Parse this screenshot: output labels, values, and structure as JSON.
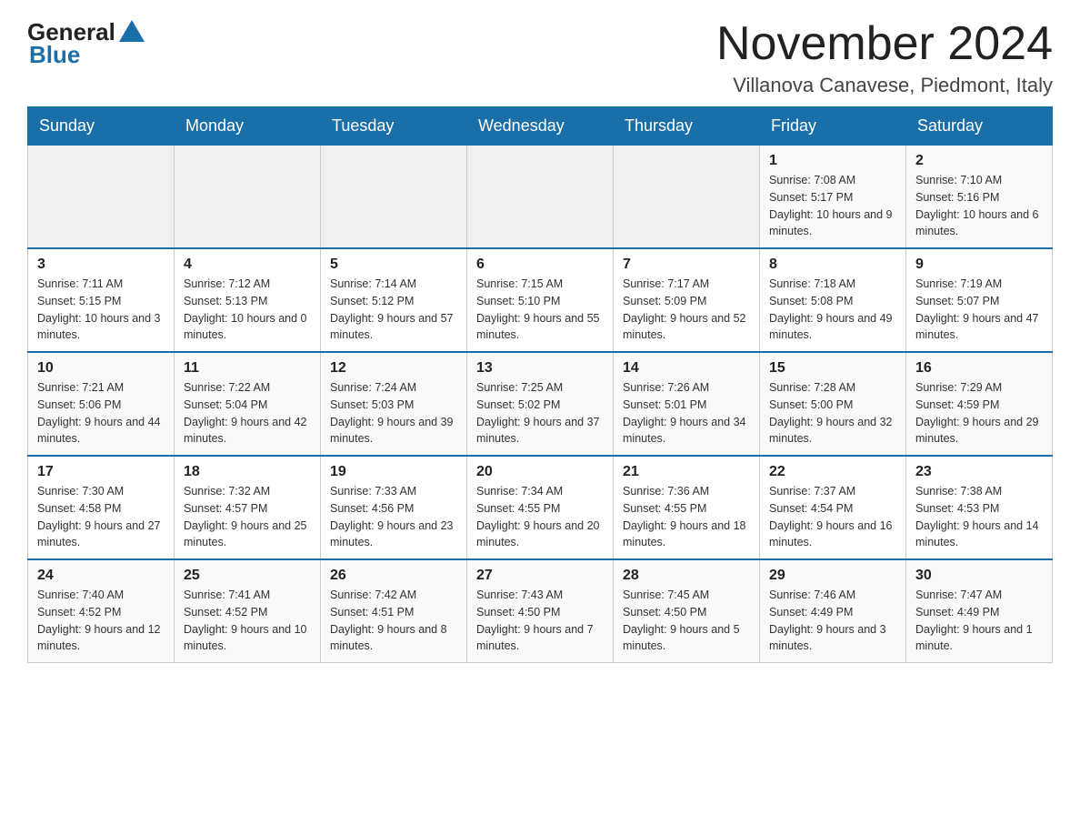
{
  "header": {
    "logo_general": "General",
    "logo_blue": "Blue",
    "month_title": "November 2024",
    "location": "Villanova Canavese, Piedmont, Italy"
  },
  "weekdays": [
    "Sunday",
    "Monday",
    "Tuesday",
    "Wednesday",
    "Thursday",
    "Friday",
    "Saturday"
  ],
  "weeks": [
    [
      {
        "day": "",
        "info": ""
      },
      {
        "day": "",
        "info": ""
      },
      {
        "day": "",
        "info": ""
      },
      {
        "day": "",
        "info": ""
      },
      {
        "day": "",
        "info": ""
      },
      {
        "day": "1",
        "info": "Sunrise: 7:08 AM\nSunset: 5:17 PM\nDaylight: 10 hours and 9 minutes."
      },
      {
        "day": "2",
        "info": "Sunrise: 7:10 AM\nSunset: 5:16 PM\nDaylight: 10 hours and 6 minutes."
      }
    ],
    [
      {
        "day": "3",
        "info": "Sunrise: 7:11 AM\nSunset: 5:15 PM\nDaylight: 10 hours and 3 minutes."
      },
      {
        "day": "4",
        "info": "Sunrise: 7:12 AM\nSunset: 5:13 PM\nDaylight: 10 hours and 0 minutes."
      },
      {
        "day": "5",
        "info": "Sunrise: 7:14 AM\nSunset: 5:12 PM\nDaylight: 9 hours and 57 minutes."
      },
      {
        "day": "6",
        "info": "Sunrise: 7:15 AM\nSunset: 5:10 PM\nDaylight: 9 hours and 55 minutes."
      },
      {
        "day": "7",
        "info": "Sunrise: 7:17 AM\nSunset: 5:09 PM\nDaylight: 9 hours and 52 minutes."
      },
      {
        "day": "8",
        "info": "Sunrise: 7:18 AM\nSunset: 5:08 PM\nDaylight: 9 hours and 49 minutes."
      },
      {
        "day": "9",
        "info": "Sunrise: 7:19 AM\nSunset: 5:07 PM\nDaylight: 9 hours and 47 minutes."
      }
    ],
    [
      {
        "day": "10",
        "info": "Sunrise: 7:21 AM\nSunset: 5:06 PM\nDaylight: 9 hours and 44 minutes."
      },
      {
        "day": "11",
        "info": "Sunrise: 7:22 AM\nSunset: 5:04 PM\nDaylight: 9 hours and 42 minutes."
      },
      {
        "day": "12",
        "info": "Sunrise: 7:24 AM\nSunset: 5:03 PM\nDaylight: 9 hours and 39 minutes."
      },
      {
        "day": "13",
        "info": "Sunrise: 7:25 AM\nSunset: 5:02 PM\nDaylight: 9 hours and 37 minutes."
      },
      {
        "day": "14",
        "info": "Sunrise: 7:26 AM\nSunset: 5:01 PM\nDaylight: 9 hours and 34 minutes."
      },
      {
        "day": "15",
        "info": "Sunrise: 7:28 AM\nSunset: 5:00 PM\nDaylight: 9 hours and 32 minutes."
      },
      {
        "day": "16",
        "info": "Sunrise: 7:29 AM\nSunset: 4:59 PM\nDaylight: 9 hours and 29 minutes."
      }
    ],
    [
      {
        "day": "17",
        "info": "Sunrise: 7:30 AM\nSunset: 4:58 PM\nDaylight: 9 hours and 27 minutes."
      },
      {
        "day": "18",
        "info": "Sunrise: 7:32 AM\nSunset: 4:57 PM\nDaylight: 9 hours and 25 minutes."
      },
      {
        "day": "19",
        "info": "Sunrise: 7:33 AM\nSunset: 4:56 PM\nDaylight: 9 hours and 23 minutes."
      },
      {
        "day": "20",
        "info": "Sunrise: 7:34 AM\nSunset: 4:55 PM\nDaylight: 9 hours and 20 minutes."
      },
      {
        "day": "21",
        "info": "Sunrise: 7:36 AM\nSunset: 4:55 PM\nDaylight: 9 hours and 18 minutes."
      },
      {
        "day": "22",
        "info": "Sunrise: 7:37 AM\nSunset: 4:54 PM\nDaylight: 9 hours and 16 minutes."
      },
      {
        "day": "23",
        "info": "Sunrise: 7:38 AM\nSunset: 4:53 PM\nDaylight: 9 hours and 14 minutes."
      }
    ],
    [
      {
        "day": "24",
        "info": "Sunrise: 7:40 AM\nSunset: 4:52 PM\nDaylight: 9 hours and 12 minutes."
      },
      {
        "day": "25",
        "info": "Sunrise: 7:41 AM\nSunset: 4:52 PM\nDaylight: 9 hours and 10 minutes."
      },
      {
        "day": "26",
        "info": "Sunrise: 7:42 AM\nSunset: 4:51 PM\nDaylight: 9 hours and 8 minutes."
      },
      {
        "day": "27",
        "info": "Sunrise: 7:43 AM\nSunset: 4:50 PM\nDaylight: 9 hours and 7 minutes."
      },
      {
        "day": "28",
        "info": "Sunrise: 7:45 AM\nSunset: 4:50 PM\nDaylight: 9 hours and 5 minutes."
      },
      {
        "day": "29",
        "info": "Sunrise: 7:46 AM\nSunset: 4:49 PM\nDaylight: 9 hours and 3 minutes."
      },
      {
        "day": "30",
        "info": "Sunrise: 7:47 AM\nSunset: 4:49 PM\nDaylight: 9 hours and 1 minute."
      }
    ]
  ]
}
